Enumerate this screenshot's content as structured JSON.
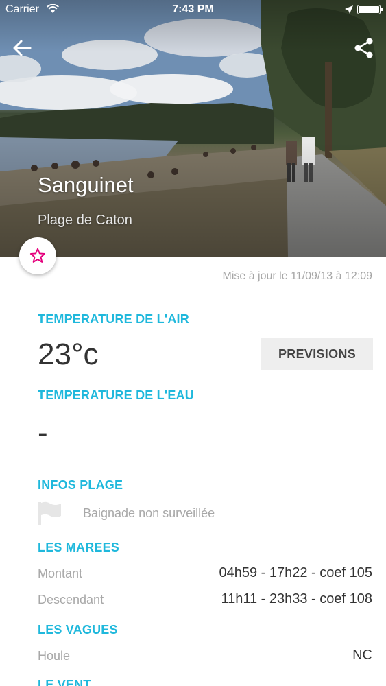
{
  "status_bar": {
    "carrier": "Carrier",
    "time": "7:43 PM"
  },
  "header": {
    "title": "Sanguinet",
    "subtitle": "Plage de Caton"
  },
  "updated": "Mise à jour le 11/09/13 à 12:09",
  "air": {
    "title": "TEMPERATURE DE L'AIR",
    "value": "23°c",
    "forecast_label": "PREVISIONS"
  },
  "water": {
    "title": "TEMPERATURE DE L'EAU",
    "value": "-"
  },
  "beach_info": {
    "title": "INFOS PLAGE",
    "status": "Baignade non surveillée"
  },
  "tides": {
    "title": "LES MAREES",
    "rows": [
      {
        "label": "Montant",
        "value": "04h59 - 17h22 - coef 105"
      },
      {
        "label": "Descendant",
        "value": "11h11 - 23h33 - coef 108"
      }
    ]
  },
  "waves": {
    "title": "LES VAGUES",
    "rows": [
      {
        "label": "Houle",
        "value": "NC"
      }
    ]
  },
  "wind": {
    "title": "LE VENT"
  },
  "colors": {
    "accent": "#1fb8dc",
    "favorite": "#e4007c"
  }
}
